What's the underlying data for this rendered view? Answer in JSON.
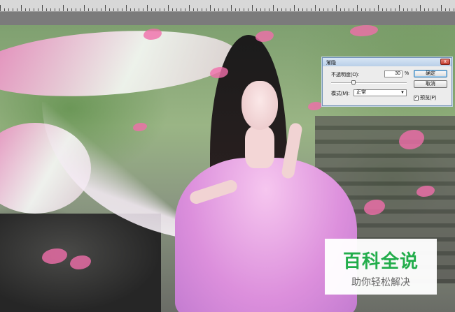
{
  "dialog": {
    "title": "渐隐",
    "opacity_label": "不透明度(O):",
    "opacity_value": "30",
    "opacity_unit": "%",
    "opacity_slider_percent": 30,
    "mode_label": "模式(M):",
    "mode_value": "正常",
    "ok_label": "确定",
    "cancel_label": "取消",
    "preview_label": "预览(P)",
    "preview_checked": true,
    "close_glyph": "x"
  },
  "watermark": {
    "title": "百科全说",
    "subtitle": "助你轻松解决",
    "title_color": "#22ad4b"
  },
  "icons": {
    "close": "close-icon",
    "dropdown": "chevron-down-icon",
    "check": "check-icon"
  }
}
